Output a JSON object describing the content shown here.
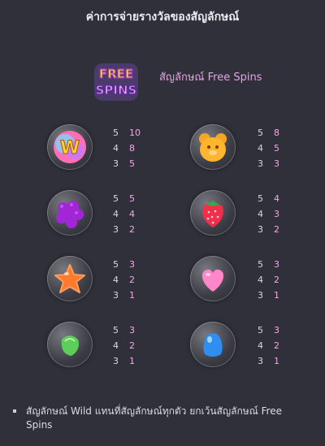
{
  "title": "ค่าการจ่ายรางวัลของสัญลักษณ์",
  "free_spins": {
    "logo_line1": "FREE",
    "logo_line2": "SPINS",
    "label": "สัญลักษณ์ Free Spins"
  },
  "symbols": [
    {
      "icon": "wild-icon",
      "rows": [
        {
          "count": "5",
          "value": "10"
        },
        {
          "count": "4",
          "value": "8"
        },
        {
          "count": "3",
          "value": "5"
        }
      ]
    },
    {
      "icon": "gummy-bear-icon",
      "rows": [
        {
          "count": "5",
          "value": "8"
        },
        {
          "count": "4",
          "value": "5"
        },
        {
          "count": "3",
          "value": "3"
        }
      ]
    },
    {
      "icon": "grape-candy-icon",
      "rows": [
        {
          "count": "5",
          "value": "5"
        },
        {
          "count": "4",
          "value": "4"
        },
        {
          "count": "3",
          "value": "2"
        }
      ]
    },
    {
      "icon": "strawberry-candy-icon",
      "rows": [
        {
          "count": "5",
          "value": "4"
        },
        {
          "count": "4",
          "value": "3"
        },
        {
          "count": "3",
          "value": "2"
        }
      ]
    },
    {
      "icon": "star-candy-icon",
      "rows": [
        {
          "count": "5",
          "value": "3"
        },
        {
          "count": "4",
          "value": "2"
        },
        {
          "count": "3",
          "value": "1"
        }
      ]
    },
    {
      "icon": "heart-candy-icon",
      "rows": [
        {
          "count": "5",
          "value": "3"
        },
        {
          "count": "4",
          "value": "2"
        },
        {
          "count": "3",
          "value": "1"
        }
      ]
    },
    {
      "icon": "green-jelly-icon",
      "rows": [
        {
          "count": "5",
          "value": "3"
        },
        {
          "count": "4",
          "value": "2"
        },
        {
          "count": "3",
          "value": "1"
        }
      ]
    },
    {
      "icon": "blue-jelly-icon",
      "rows": [
        {
          "count": "5",
          "value": "3"
        },
        {
          "count": "4",
          "value": "2"
        },
        {
          "count": "3",
          "value": "1"
        }
      ]
    }
  ],
  "note": "สัญลักษณ์ Wild แทนที่สัญลักษณ์ทุกตัว ยกเว้นสัญลักษณ์ Free Spins"
}
